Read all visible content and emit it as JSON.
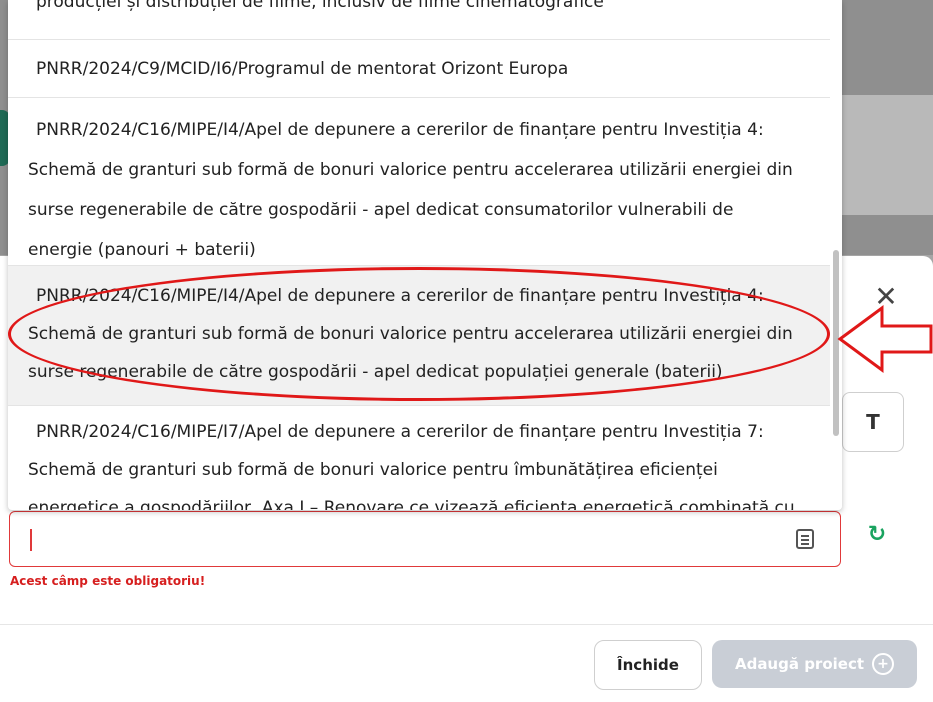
{
  "dropdown": {
    "items": [
      {
        "lines": [
          "producției și distribuției de filme, inclusiv de filme cinematografice"
        ]
      },
      {
        "lines": [
          "PNRR/2024/C9/MCID/I6/Programul de mentorat Orizont Europa"
        ]
      },
      {
        "lines": [
          "PNRR/2024/C16/MIPE/I4/Apel de depunere a cererilor de finanțare pentru Investiția 4:",
          "Schemă de granturi sub formă de bonuri valorice pentru accelerarea utilizării energiei din",
          "surse regenerabile de către gospodării  - apel dedicat consumatorilor vulnerabili de",
          "energie (panouri + baterii)"
        ]
      },
      {
        "lines": [
          "PNRR/2024/C16/MIPE/I4/Apel de depunere a cererilor de finanțare pentru Investiția 4:",
          "Schemă de granturi sub formă de bonuri valorice pentru accelerarea utilizării energiei din",
          "surse regenerabile de către gospodării  - apel dedicat populației generale (baterii)"
        ]
      },
      {
        "lines": [
          "PNRR/2024/C16/MIPE/I7/Apel de depunere a cererilor de finanțare pentru Investiția 7:",
          "Schemă de granturi sub formă de bonuri valorice pentru îmbunătățirea eficienței",
          "energetice a gospodăriilor, Axa I – Renovare ce vizează eficiența energetică combinată cu"
        ]
      }
    ]
  },
  "modal": {
    "close_symbol": "✕",
    "side_button_label": "T",
    "input_value": "",
    "error_text": "Acest câmp este obligatoriu!",
    "close_button_label": "Închide",
    "add_button_label": "Adaugă proiect",
    "add_button_icon": "+"
  },
  "colors": {
    "error": "#e0393a",
    "annotation": "#e01818",
    "refresh": "#1aa35f",
    "disabled_button": "#c9ced6"
  }
}
